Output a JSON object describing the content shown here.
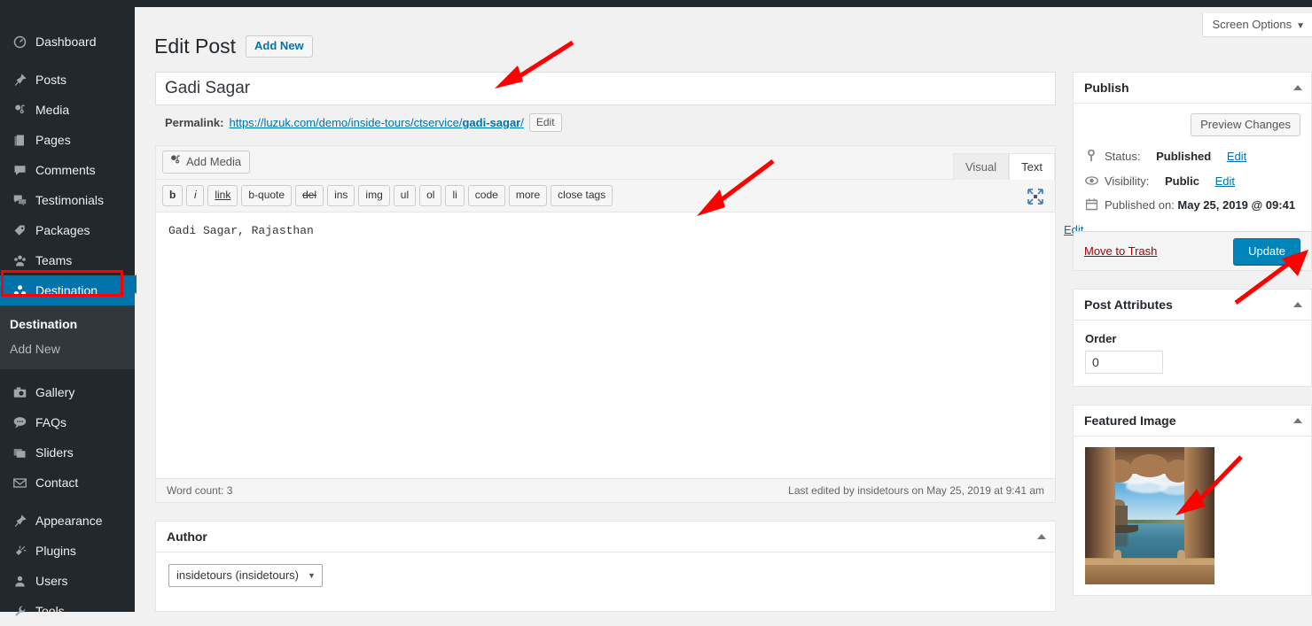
{
  "adminbar": {
    "glyphs": [
      "ⓘ",
      "▣",
      "✎",
      "✚"
    ]
  },
  "sidebar": {
    "items": [
      {
        "label": "Dashboard",
        "icon": "dashboard-icon",
        "glyph": "◔",
        "current": false,
        "sep_after": true
      },
      {
        "label": "Posts",
        "icon": "pin-icon",
        "glyph": "✒",
        "current": false
      },
      {
        "label": "Media",
        "icon": "media-icon",
        "glyph": "♫",
        "current": false
      },
      {
        "label": "Pages",
        "icon": "pages-icon",
        "glyph": "❐",
        "current": false
      },
      {
        "label": "Comments",
        "icon": "comment-icon",
        "glyph": "⬛",
        "current": false
      },
      {
        "label": "Testimonials",
        "icon": "testimonials-icon",
        "glyph": "⬛",
        "current": false
      },
      {
        "label": "Packages",
        "icon": "tag-icon",
        "glyph": "◢",
        "current": false
      },
      {
        "label": "Teams",
        "icon": "teams-icon",
        "glyph": "☵",
        "current": false
      },
      {
        "label": "Destination",
        "icon": "destination-icon",
        "glyph": "∴",
        "current": true
      }
    ],
    "submenu": [
      {
        "label": "Destination",
        "current": true
      },
      {
        "label": "Add New",
        "current": false
      }
    ],
    "items2": [
      {
        "label": "Gallery",
        "icon": "camera-icon",
        "glyph": "▣"
      },
      {
        "label": "FAQs",
        "icon": "faq-icon",
        "glyph": "⬛"
      },
      {
        "label": "Sliders",
        "icon": "sliders-icon",
        "glyph": "▤"
      },
      {
        "label": "Contact",
        "icon": "envelope-icon",
        "glyph": "✉"
      }
    ],
    "items3": [
      {
        "label": "Appearance",
        "icon": "brush-icon",
        "glyph": "✒"
      },
      {
        "label": "Plugins",
        "icon": "plug-icon",
        "glyph": "⚡"
      },
      {
        "label": "Users",
        "icon": "user-icon",
        "glyph": "♟"
      },
      {
        "label": "Tools",
        "icon": "wrench-icon",
        "glyph": "⚒"
      }
    ]
  },
  "screen_options": {
    "label": "Screen Options",
    "caret": "▼"
  },
  "header": {
    "title": "Edit Post",
    "add_new": "Add New"
  },
  "post": {
    "title": "Gadi Sagar",
    "permalink_label": "Permalink:",
    "permalink_base": "https://luzuk.com/demo/inside-tours/ctservice/",
    "permalink_slug": "gadi-sagar",
    "permalink_tail": "/",
    "edit_slug": "Edit"
  },
  "editor": {
    "add_media": "Add Media",
    "tabs": [
      {
        "label": "Visual",
        "active": false
      },
      {
        "label": "Text",
        "active": true
      }
    ],
    "quicktags": [
      "b",
      "i",
      "link",
      "b-quote",
      "del",
      "ins",
      "img",
      "ul",
      "ol",
      "li",
      "code",
      "more",
      "close tags"
    ],
    "content": "Gadi Sagar, Rajasthan",
    "word_count": "Word count: 3",
    "last_edited": "Last edited by insidetours on May 25, 2019 at 9:41 am"
  },
  "author_box": {
    "title": "Author",
    "selected": "insidetours (insidetours)",
    "caret": "▼"
  },
  "publish": {
    "title": "Publish",
    "preview_changes": "Preview Changes",
    "status_label": "Status:",
    "status_value": "Published",
    "status_edit": "Edit",
    "visibility_label": "Visibility:",
    "visibility_value": "Public",
    "visibility_edit": "Edit",
    "published_label": "Published on:",
    "published_value": "May 25, 2019 @ 09:41",
    "published_edit": "Edit",
    "move_to_trash": "Move to Trash",
    "update": "Update",
    "icons": {
      "status": "⚑",
      "visibility": "◉",
      "calendar": "▦"
    }
  },
  "post_attributes": {
    "title": "Post Attributes",
    "order_label": "Order",
    "order_value": "0"
  },
  "featured_image": {
    "title": "Featured Image",
    "alt": "Gadi Sagar lake viewed through a carved stone arch"
  },
  "colors": {
    "accent": "#0073aa",
    "update_button": "#0085ba",
    "annotation": "#ff0000",
    "sidebar_bg": "#23282d",
    "trash_link": "#a00"
  }
}
